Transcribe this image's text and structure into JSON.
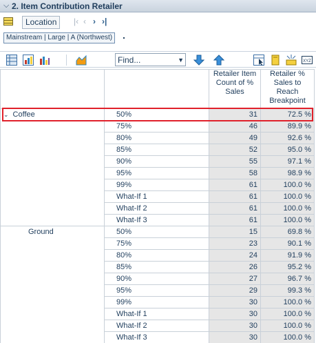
{
  "titlebar": {
    "title": "2. Item Contribution Retailer"
  },
  "navigation": {
    "location_label": "Location"
  },
  "filter": {
    "chip_label": "Mainstream | Large | A (Northwest)"
  },
  "toolbar": {
    "find_value": "Find..."
  },
  "table": {
    "headers": [
      "Retailer Item Count of % Sales",
      "Retailer % Sales to Reach Breakpoint"
    ],
    "groups": [
      {
        "label": "Coffee",
        "rows": [
          {
            "criteria": "50%",
            "count": "31",
            "pct": "72.5 %"
          },
          {
            "criteria": "75%",
            "count": "46",
            "pct": "89.9 %"
          },
          {
            "criteria": "80%",
            "count": "49",
            "pct": "92.6 %"
          },
          {
            "criteria": "85%",
            "count": "52",
            "pct": "95.0 %"
          },
          {
            "criteria": "90%",
            "count": "55",
            "pct": "97.1 %"
          },
          {
            "criteria": "95%",
            "count": "58",
            "pct": "98.9 %"
          },
          {
            "criteria": "99%",
            "count": "61",
            "pct": "100.0 %"
          },
          {
            "criteria": "What-If 1",
            "count": "61",
            "pct": "100.0 %"
          },
          {
            "criteria": "What-If 2",
            "count": "61",
            "pct": "100.0 %"
          },
          {
            "criteria": "What-If 3",
            "count": "61",
            "pct": "100.0 %"
          }
        ]
      },
      {
        "label": "Ground",
        "rows": [
          {
            "criteria": "50%",
            "count": "15",
            "pct": "69.8 %"
          },
          {
            "criteria": "75%",
            "count": "23",
            "pct": "90.1 %"
          },
          {
            "criteria": "80%",
            "count": "24",
            "pct": "91.9 %"
          },
          {
            "criteria": "85%",
            "count": "26",
            "pct": "95.2 %"
          },
          {
            "criteria": "90%",
            "count": "27",
            "pct": "96.7 %"
          },
          {
            "criteria": "95%",
            "count": "29",
            "pct": "99.3 %"
          },
          {
            "criteria": "99%",
            "count": "30",
            "pct": "100.0 %"
          },
          {
            "criteria": "What-If 1",
            "count": "30",
            "pct": "100.0 %"
          },
          {
            "criteria": "What-If 2",
            "count": "30",
            "pct": "100.0 %"
          },
          {
            "criteria": "What-If 3",
            "count": "30",
            "pct": "100.0 %"
          }
        ]
      }
    ]
  },
  "colors": {
    "highlight": "#e0202a",
    "value_cell_bg": "#e6e6e6",
    "text": "#1f3d5c"
  }
}
